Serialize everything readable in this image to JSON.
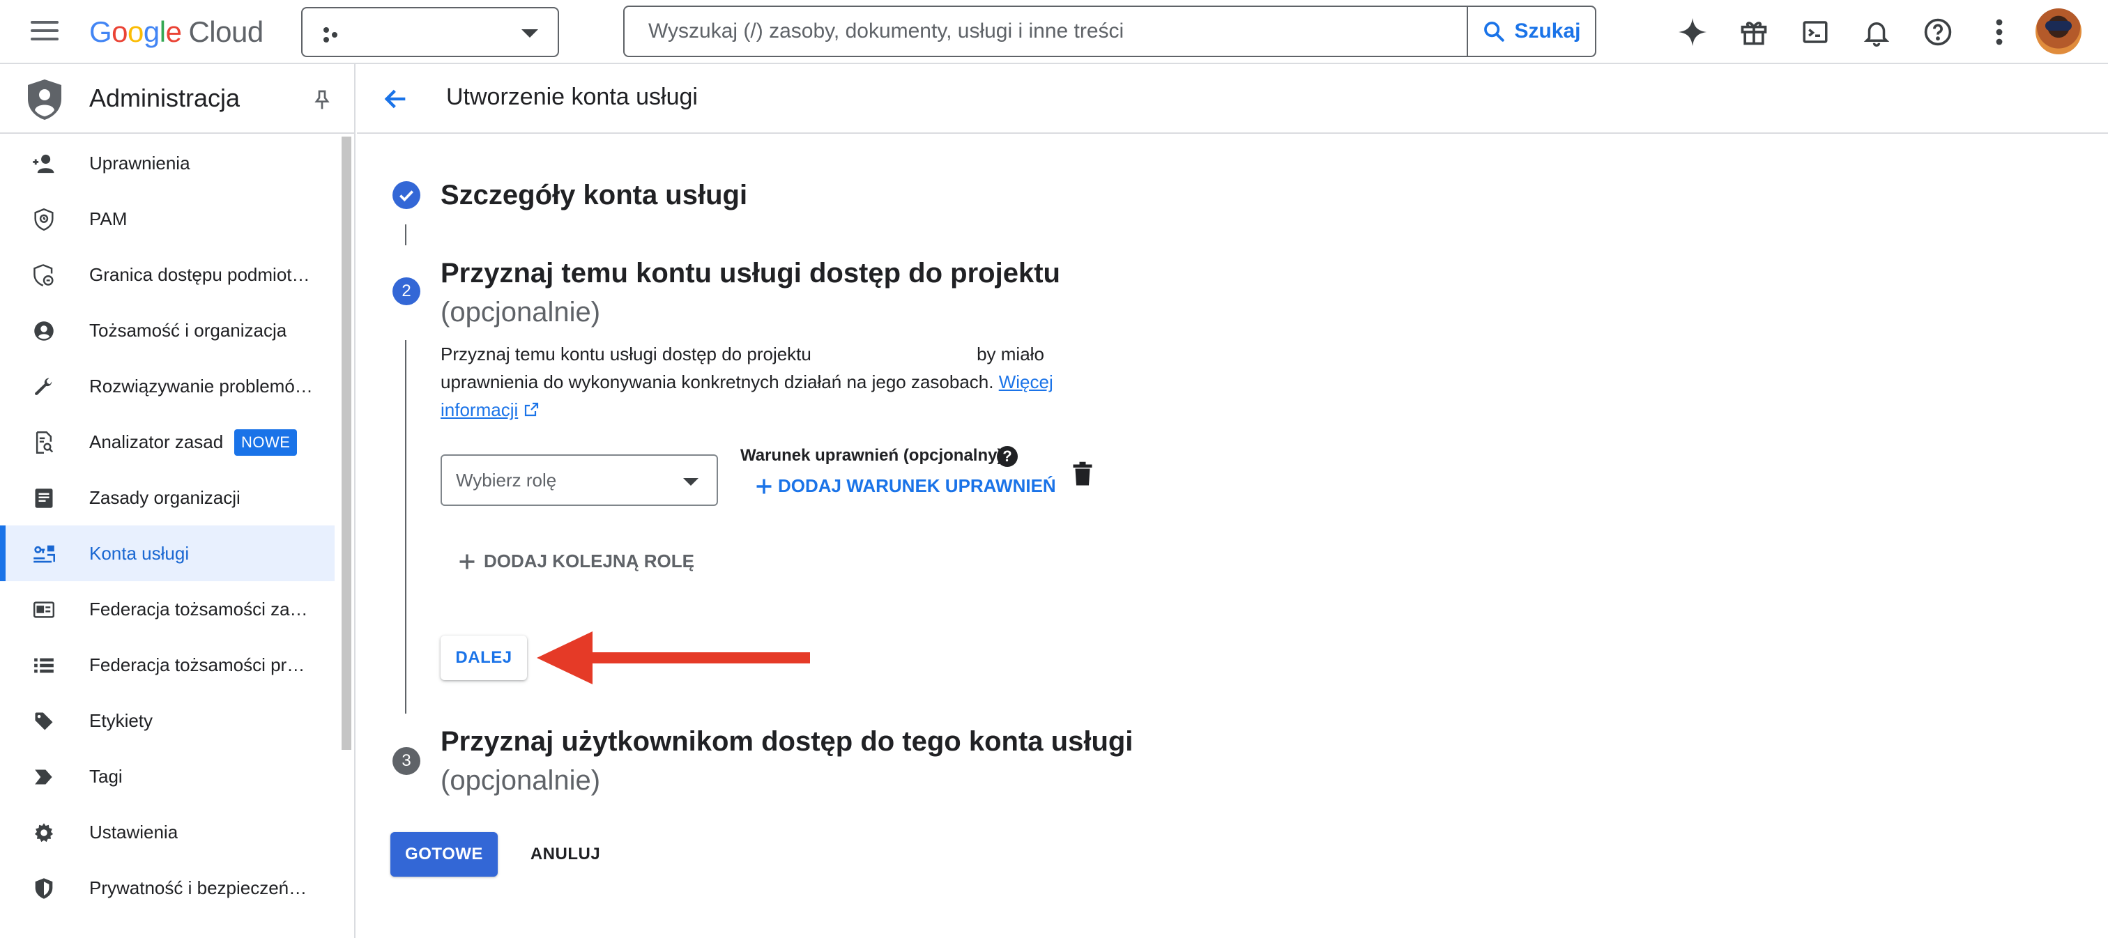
{
  "topbar": {
    "logo_google": "Google",
    "logo_cloud": "Cloud",
    "search_placeholder": "Wyszukaj (/) zasoby, dokumenty, usługi i inne treści",
    "search_button": "Szukaj",
    "icons": [
      "menu-icon",
      "project-icon",
      "gemini-sparkle-icon",
      "gift-icon",
      "cloud-shell-icon",
      "notifications-bell-icon",
      "help-icon",
      "more-vert-icon",
      "avatar"
    ]
  },
  "sidebar": {
    "title": "Administracja",
    "items": [
      {
        "label": "Uprawnienia",
        "icon": "person-add-icon"
      },
      {
        "label": "PAM",
        "icon": "shield-clock-icon"
      },
      {
        "label": "Granica dostępu podmiot…",
        "icon": "security-boundary-icon"
      },
      {
        "label": "Tożsamość i organizacja",
        "icon": "account-circle-icon"
      },
      {
        "label": "Rozwiązywanie problemó…",
        "icon": "wrench-icon"
      },
      {
        "label": "Analizator zasad",
        "icon": "policy-analyzer-icon",
        "badge": "NOWE"
      },
      {
        "label": "Zasady organizacji",
        "icon": "document-icon"
      },
      {
        "label": "Konta usługi",
        "icon": "service-account-icon",
        "active": true
      },
      {
        "label": "Federacja tożsamości za…",
        "icon": "id-card-icon"
      },
      {
        "label": "Federacja tożsamości pra…",
        "icon": "list-icon"
      },
      {
        "label": "Etykiety",
        "icon": "label-tag-icon"
      },
      {
        "label": "Tagi",
        "icon": "tag-chevron-icon"
      },
      {
        "label": "Ustawienia",
        "icon": "gear-icon"
      },
      {
        "label": "Prywatność i bezpieczeńs…",
        "icon": "privacy-shield-icon"
      }
    ]
  },
  "main": {
    "page_title": "Utworzenie konta usługi",
    "step1_title": "Szczegóły konta usługi",
    "step2_number": "2",
    "step2_title": "Przyznaj temu kontu usługi dostęp do projektu",
    "step2_subtitle": "(opcjonalnie)",
    "step2_desc_part1": "Przyznaj temu kontu usługi dostęp do projektu",
    "step2_desc_part2": "by miało uprawnienia do wykonywania konkretnych działań na jego zasobach.",
    "learn_more_link": "Więcej informacji",
    "role_placeholder": "Wybierz rolę",
    "condition_label": "Warunek uprawnień (opcjonalny)",
    "add_condition": "DODAJ WARUNEK UPRAWNIEŃ",
    "add_another_role": "DODAJ KOLEJNĄ ROLĘ",
    "continue_button": "DALEJ",
    "step3_number": "3",
    "step3_title": "Przyznaj użytkownikom dostęp do tego konta usługi",
    "step3_subtitle": "(opcjonalnie)",
    "done_button": "GOTOWE",
    "cancel_button": "ANULUJ",
    "accent_color": "#1a73e8",
    "annotation_arrow_color": "#e53a27"
  }
}
